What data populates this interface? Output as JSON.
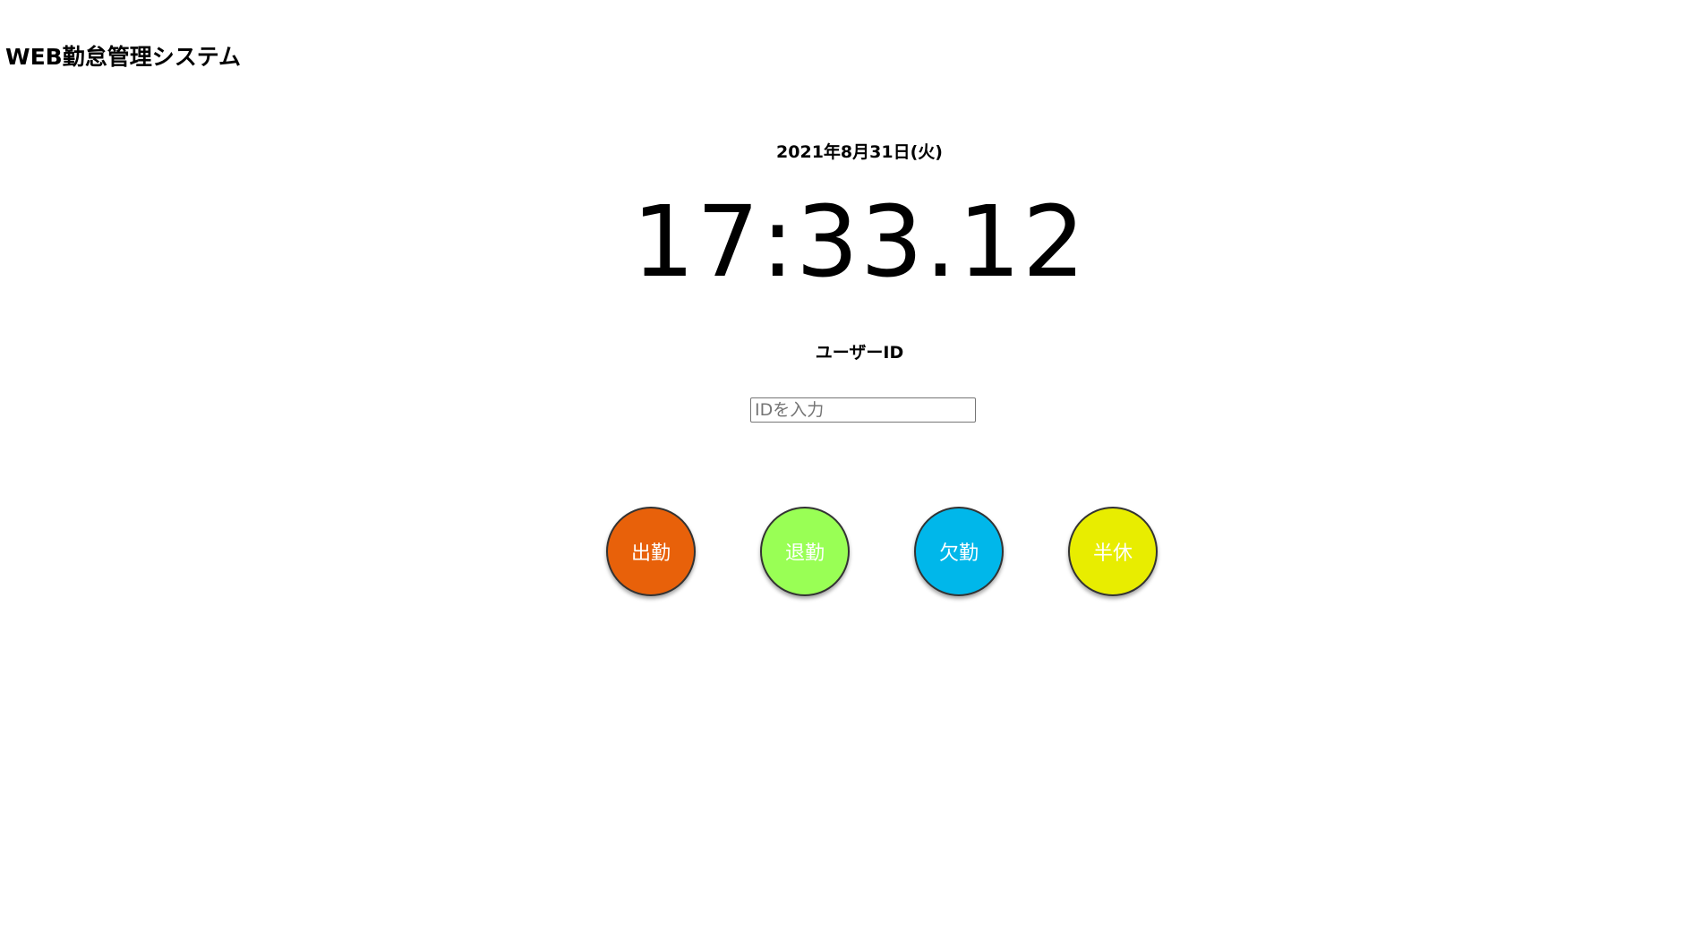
{
  "header": {
    "app_title": "WEB勤怠管理システム"
  },
  "clock": {
    "date": "2021年8月31日(火)",
    "time": "17:33.12"
  },
  "form": {
    "id_label": "ユーザーID",
    "id_value": "",
    "id_placeholder": "IDを入力"
  },
  "actions": [
    {
      "label": "出勤",
      "color": "#e8610a"
    },
    {
      "label": "退勤",
      "color": "#99ff55"
    },
    {
      "label": "欠勤",
      "color": "#00b7ea"
    },
    {
      "label": "半休",
      "color": "#e8ed00"
    }
  ]
}
